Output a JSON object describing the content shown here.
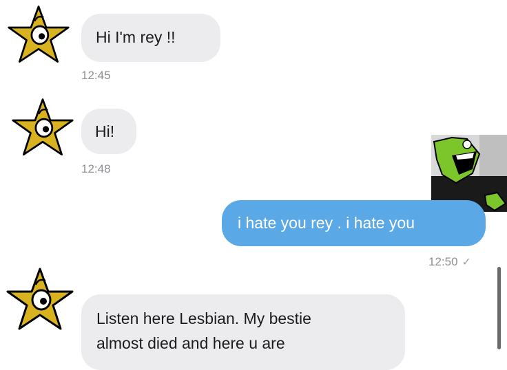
{
  "messages": [
    {
      "text": "Hi I'm rey !!",
      "time": "12:45",
      "direction": "incoming"
    },
    {
      "text": "Hi!",
      "time": "12:48",
      "direction": "incoming"
    },
    {
      "text": "i hate you rey . i hate you",
      "time": "12:50",
      "direction": "outgoing",
      "status_icon": "check-icon"
    },
    {
      "text_line1": "Listen here Lesbian. My bestie",
      "text_line2": "almost died and here u are",
      "direction": "incoming"
    }
  ],
  "colors": {
    "incoming_bubble": "#ececee",
    "outgoing_bubble": "#5aa9e6",
    "timestamp": "#8e8e93",
    "avatar_star": "#d8b21f"
  },
  "icons": {
    "avatar": "star-face-icon",
    "sticker": "green-character-sticker",
    "status": "check-icon"
  }
}
